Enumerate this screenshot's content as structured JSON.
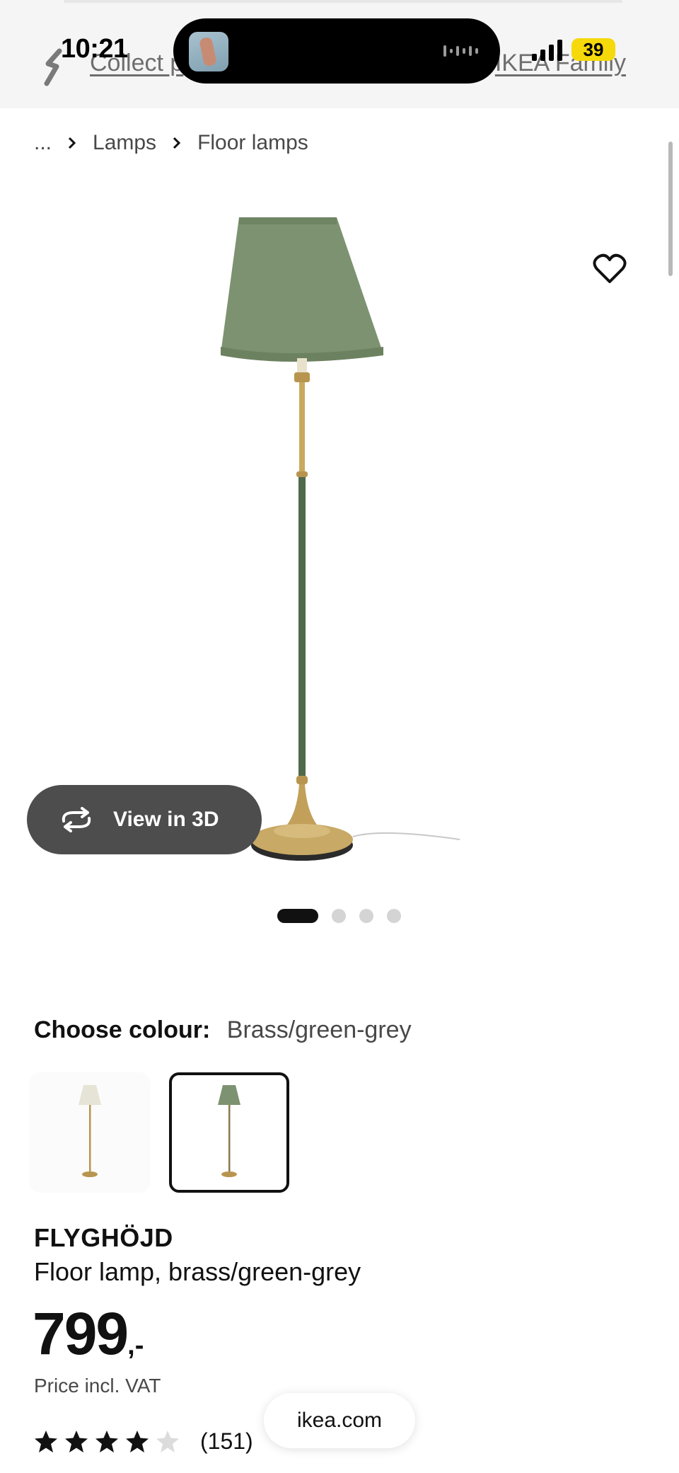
{
  "status_bar": {
    "time": "10:21",
    "battery": "39"
  },
  "banner": {
    "collect_link": "Collect p",
    "family_link": "IKEA Family"
  },
  "breadcrumb": {
    "items": [
      "...",
      "Lamps",
      "Floor lamps"
    ]
  },
  "gallery": {
    "view_3d_label": "View in 3D",
    "image_count": 4,
    "active_index": 0
  },
  "colour": {
    "label": "Choose colour:",
    "selected": "Brass/green-grey",
    "options": [
      "white",
      "green-grey"
    ],
    "selected_index": 1
  },
  "product": {
    "brand": "FLYGHÖJD",
    "description": "Floor lamp, brass/green-grey",
    "price_main": "799",
    "price_suffix": ",-",
    "vat_note": "Price incl. VAT",
    "rating_stars": 4,
    "rating_max": 5,
    "review_count": "(151)"
  },
  "browser": {
    "url": "ikea.com"
  },
  "colors": {
    "shade_green": "#7d9270",
    "brass": "#b8954f",
    "stem_green": "#4f6a4a",
    "button_dark": "#4d4d4d",
    "battery_yellow": "#f5d90a"
  }
}
